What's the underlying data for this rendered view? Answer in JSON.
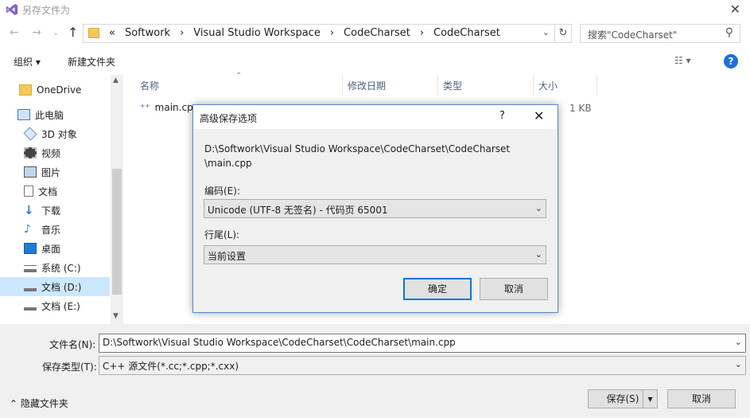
{
  "window": {
    "title": "另存文件为"
  },
  "nav": {
    "breadcrumb_overflow": "«",
    "breadcrumbs": [
      "Softwork",
      "Visual Studio Workspace",
      "CodeCharset",
      "CodeCharset"
    ],
    "search_placeholder": "搜索\"CodeCharset\""
  },
  "toolbar": {
    "organize": "组织 ▾",
    "new_folder": "新建文件夹"
  },
  "sidebar": {
    "items": [
      {
        "label": "OneDrive",
        "icon": "folder-icon"
      },
      {
        "label": "此电脑",
        "icon": "computer-icon"
      },
      {
        "label": "3D 对象",
        "icon": "cube-icon"
      },
      {
        "label": "视频",
        "icon": "video-icon"
      },
      {
        "label": "图片",
        "icon": "picture-icon"
      },
      {
        "label": "文档",
        "icon": "document-icon"
      },
      {
        "label": "下载",
        "icon": "download-icon"
      },
      {
        "label": "音乐",
        "icon": "music-icon"
      },
      {
        "label": "桌面",
        "icon": "desktop-icon"
      },
      {
        "label": "系统 (C:)",
        "icon": "drive-icon"
      },
      {
        "label": "文档 (D:)",
        "icon": "drive-icon",
        "selected": true
      },
      {
        "label": "文档 (E:)",
        "icon": "drive-icon"
      }
    ]
  },
  "filelist": {
    "columns": [
      "名称",
      "修改日期",
      "类型",
      "大小"
    ],
    "files": [
      {
        "name": "main.cpp",
        "size": "1 KB"
      }
    ]
  },
  "bottom": {
    "filename_label": "文件名(N):",
    "filename_value": "D:\\Softwork\\Visual Studio Workspace\\CodeCharset\\CodeCharset\\main.cpp",
    "filetype_label": "保存类型(T):",
    "filetype_value": "C++ 源文件(*.cc;*.cpp;*.cxx)",
    "hide_folders": "隐藏文件夹",
    "save": "保存(S)",
    "cancel": "取消"
  },
  "dialog": {
    "title": "高级保存选项",
    "help": "?",
    "path_line1": "D:\\Softwork\\Visual Studio Workspace\\CodeCharset\\CodeCharset",
    "path_line2": "\\main.cpp",
    "encoding_label": "编码(E):",
    "encoding_value": "Unicode (UTF-8 无签名) - 代码页 65001",
    "lineend_label": "行尾(L):",
    "lineend_value": "当前设置",
    "ok": "确定",
    "cancel": "取消"
  },
  "colors": {
    "accent": "#0078d7",
    "selection": "#cce8ff",
    "help": "#1e6fd9",
    "vs_purple": "#865fc5"
  }
}
